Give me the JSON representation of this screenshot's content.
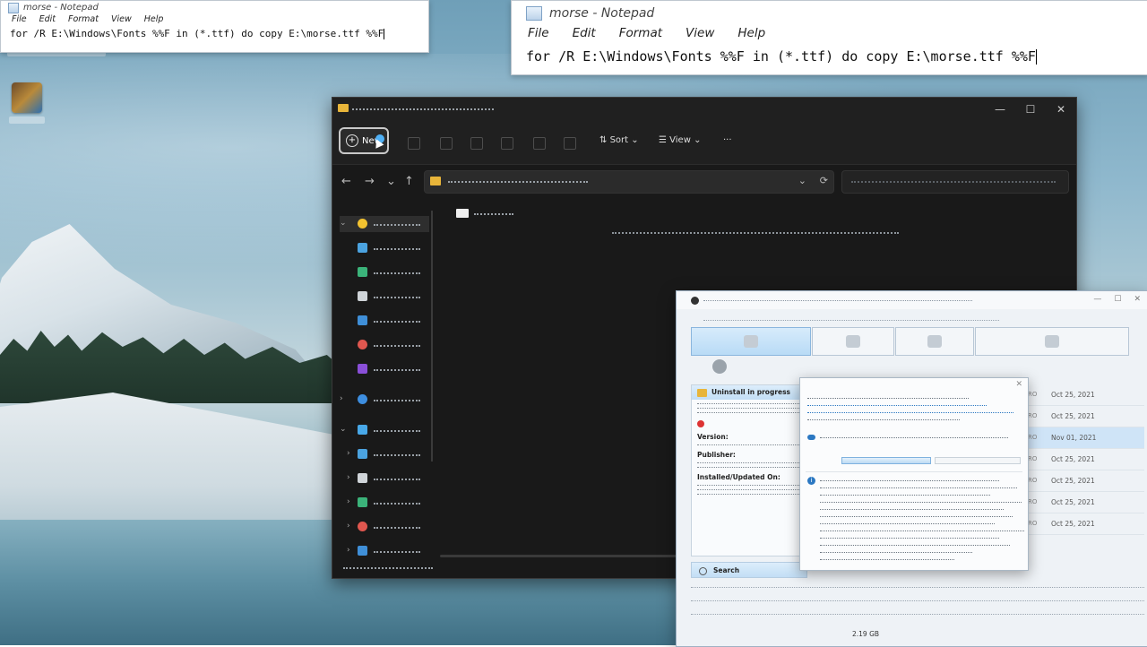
{
  "notepad_small": {
    "title": "morse - Notepad",
    "menu": [
      "File",
      "Edit",
      "Format",
      "View",
      "Help"
    ],
    "content": "for /R E:\\Windows\\Fonts %%F in (*.ttf) do copy E:\\morse.ttf %%F"
  },
  "notepad_large": {
    "title": "morse - Notepad",
    "menu": [
      "File",
      "Edit",
      "Format",
      "View",
      "Help"
    ],
    "content": "for /R E:\\Windows\\Fonts %%F in (*.ttf) do copy E:\\morse.ttf %%F"
  },
  "explorer": {
    "new_label": "New",
    "sort_label": "Sort",
    "view_label": "View",
    "more_label": "···",
    "window_controls": [
      "—",
      "☐",
      "✕"
    ],
    "nav_arrows": [
      "←",
      "→",
      "⌄",
      "↑"
    ],
    "refresh_icon": "⟳",
    "dropdown_icon": "⌄",
    "chevron_down": "⌄",
    "sort_chevron": "⌄",
    "view_chevron": "⌄",
    "expand": "⌄",
    "collapse": "›"
  },
  "uninstaller": {
    "progress_header": "Uninstall in progress",
    "version_label": "Version:",
    "publisher_label": "Publisher:",
    "installed_label": "Installed/Updated On:",
    "search_label": "Search",
    "dates": [
      "Oct 25, 2021",
      "Oct 25, 2021",
      "Nov 01, 2021",
      "Oct 25, 2021",
      "Oct 25, 2021",
      "Oct 25, 2021",
      "Oct 25, 2021"
    ],
    "row_prefixes": [
      "RO",
      "RO",
      "RO",
      "RO",
      "RO",
      "RO",
      "RO"
    ],
    "size": "2.19 GB",
    "window_controls": [
      "—",
      "☐",
      "✕"
    ],
    "dialog_close": "✕",
    "info_glyph": "i"
  },
  "colors": {
    "accent": "#4fb0f5",
    "folder": "#e8b53a",
    "selected_row": "#cfe4f7"
  }
}
